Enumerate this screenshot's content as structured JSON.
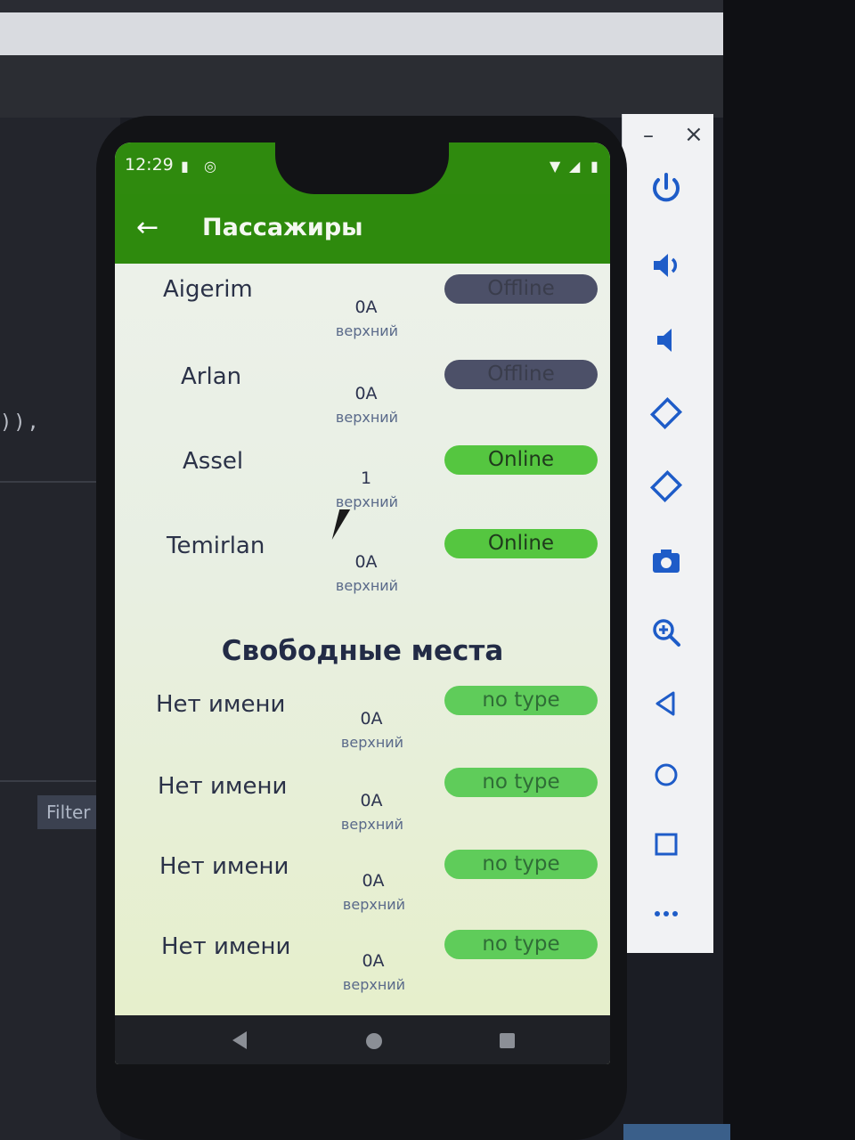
{
  "ide": {
    "code_snippet": ")),",
    "filter_label": "Filter (e"
  },
  "statusbar": {
    "time": "12:29"
  },
  "appbar": {
    "back_icon": "arrow-left-icon",
    "title": "Пассажиры"
  },
  "passengers": [
    {
      "name": "Aigerim",
      "seat": "0A",
      "seat_type": "верхний",
      "status": "Offline"
    },
    {
      "name": "Arlan",
      "seat": "0A",
      "seat_type": "верхний",
      "status": "Offline"
    },
    {
      "name": "Assel",
      "seat": "1",
      "seat_type": "верхний",
      "status": "Online"
    },
    {
      "name": "Temirlan",
      "seat": "0A",
      "seat_type": "верхний",
      "status": "Online"
    }
  ],
  "free_section": {
    "title": "Свободные места",
    "seats": [
      {
        "name": "Нет имени",
        "seat": "0A",
        "seat_type": "верхний",
        "status": "no type"
      },
      {
        "name": "Нет имени",
        "seat": "0A",
        "seat_type": "верхний",
        "status": "no type"
      },
      {
        "name": "Нет имени",
        "seat": "0A",
        "seat_type": "верхний",
        "status": "no type"
      },
      {
        "name": "Нет имени",
        "seat": "0A",
        "seat_type": "верхний",
        "status": "no type"
      }
    ]
  },
  "colors": {
    "appbar": "#2e8a0d",
    "offline": "#4c5068",
    "online": "#55c640",
    "notype": "#5fcc5a",
    "emulator_icons": "#1e5cc8"
  },
  "emulator_panel": {
    "minimize": "–",
    "close": "×",
    "icons": [
      "power-icon",
      "volume-up-icon",
      "volume-down-icon",
      "rotate-left-icon",
      "rotate-right-icon",
      "camera-icon",
      "zoom-icon",
      "back-icon",
      "home-icon",
      "overview-icon",
      "more-icon"
    ]
  }
}
